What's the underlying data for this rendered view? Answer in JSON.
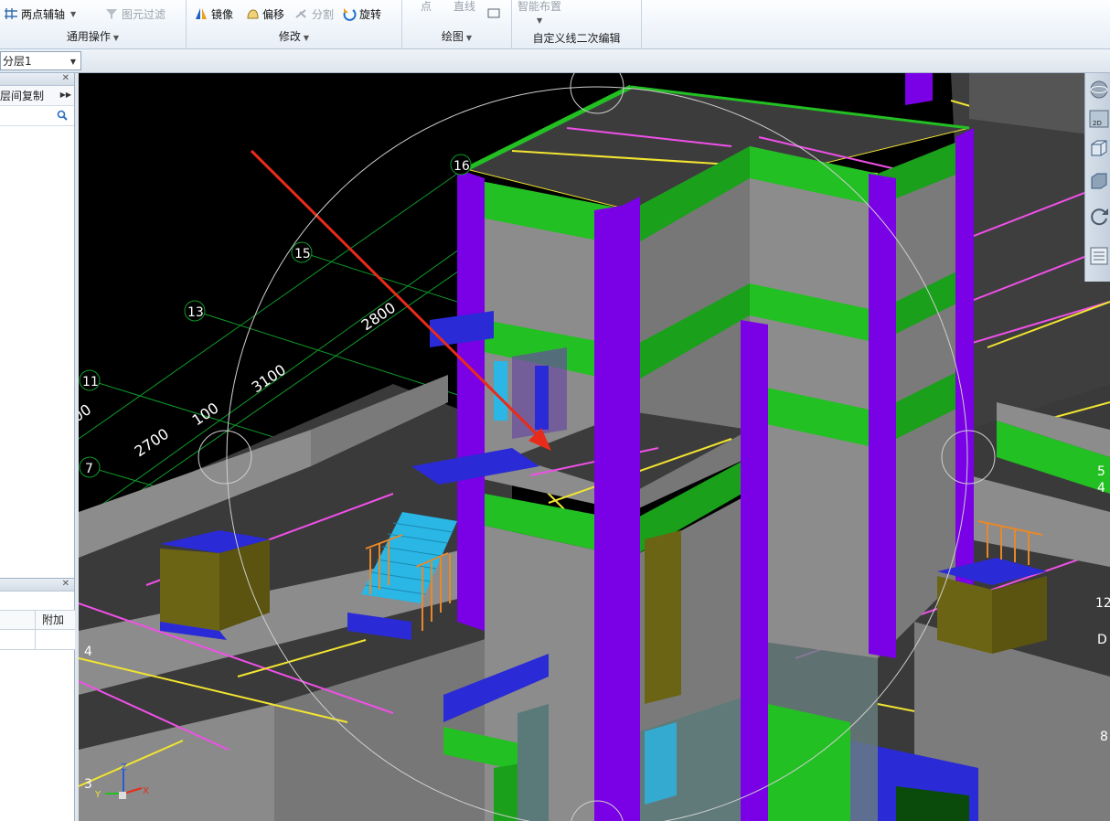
{
  "ribbon": {
    "two_point_axis": "两点辅轴",
    "element_filter": "图元过滤",
    "group_general": "通用操作",
    "mirror": "镜像",
    "offset": "偏移",
    "split": "分割",
    "rotate": "旋转",
    "group_modify": "修改",
    "point": "点",
    "line": "直线",
    "group_draw": "绘图",
    "smart_layout": "智能布置",
    "group_custom": "自定义线二次编辑"
  },
  "layer_select": {
    "value": "分层1"
  },
  "left_panel": {
    "copy_between_floors": "层间复制",
    "search_placeholder": ""
  },
  "left_panel2": {
    "col_extra": "附加"
  },
  "viewport": {
    "axis_labels": [
      "16",
      "15",
      "13",
      "11",
      "7",
      "4",
      "3",
      "5",
      "4",
      "D",
      "8",
      "12"
    ],
    "dimensions": [
      "2800",
      "3100",
      "100",
      "2700",
      "00"
    ],
    "view_2d": "2D",
    "axes": {
      "x": "X",
      "y": "Y",
      "z": "Z"
    }
  },
  "colors": {
    "background": "#000000",
    "column": "#7a00e6",
    "beam": "#22c022",
    "wall": "#8c8c8c",
    "slab": "#3c3c3c",
    "stair": "#2ab7e6",
    "slab_edge_yellow": "#f2e531",
    "slab_edge_magenta": "#f050e8",
    "grid": "#0f9a2a",
    "arrow": "#e82b1a",
    "balcony": "#6b6414",
    "blue_element": "#2a2ad6"
  }
}
